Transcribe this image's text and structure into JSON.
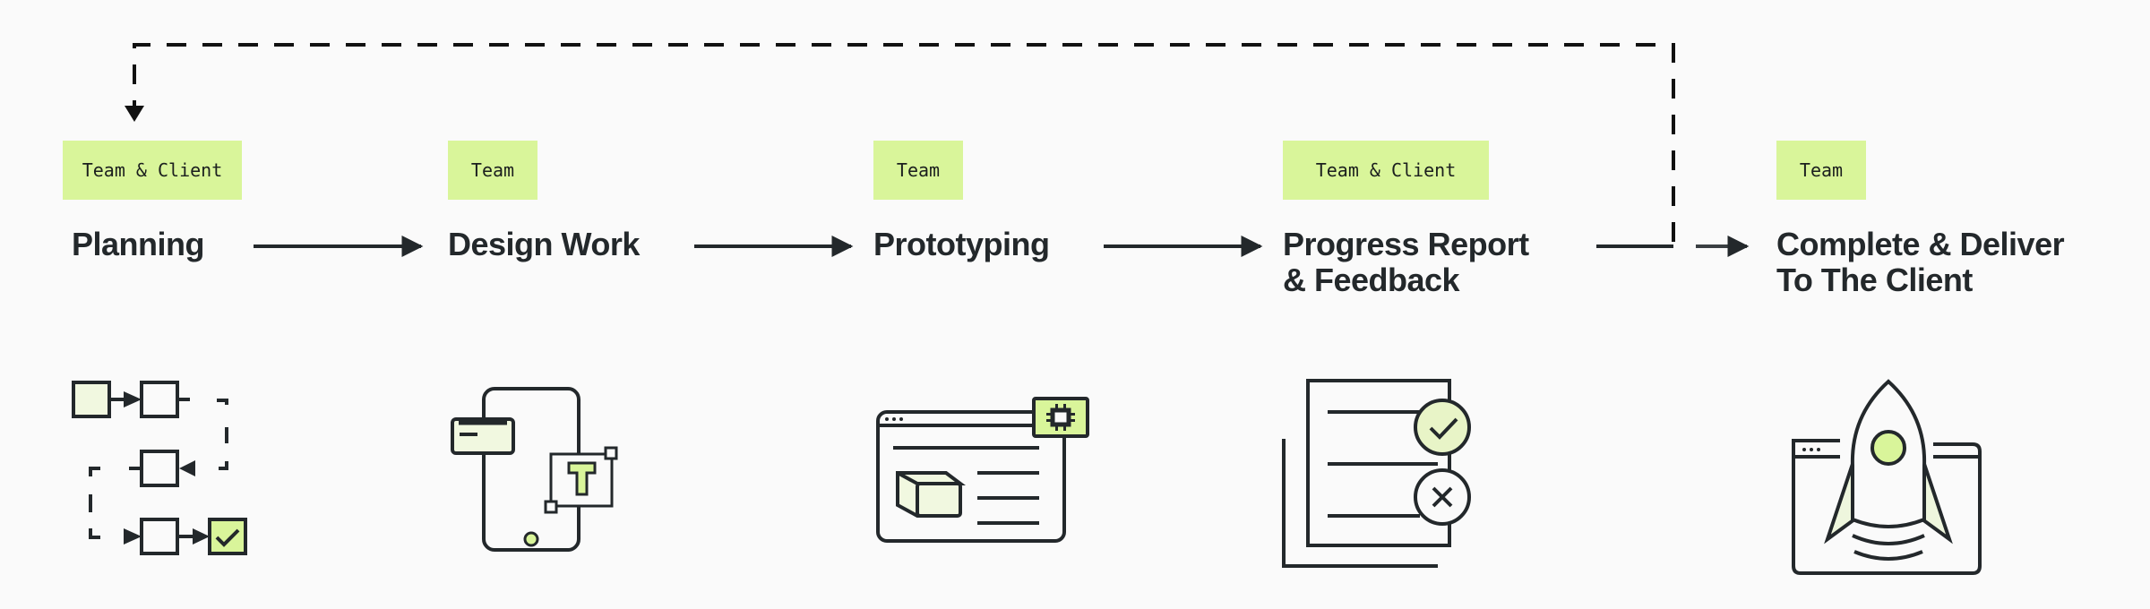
{
  "steps": [
    {
      "tag": "Team & Client",
      "title_line1": "Planning",
      "title_line2": "",
      "icon": "flowchart-icon"
    },
    {
      "tag": "Team",
      "title_line1": "Design Work",
      "title_line2": "",
      "icon": "mobile-design-icon"
    },
    {
      "tag": "Team",
      "title_line1": "Prototyping",
      "title_line2": "",
      "icon": "browser-prototype-icon"
    },
    {
      "tag": "Team & Client",
      "title_line1": "Progress Report",
      "title_line2": "& Feedback",
      "icon": "document-review-icon"
    },
    {
      "tag": "Team",
      "title_line1": "Complete & Deliver",
      "title_line2": "To The Client",
      "icon": "rocket-launch-icon"
    }
  ],
  "colors": {
    "accent": "#d9f59a",
    "accent_light": "#f1f8e0",
    "ink": "#23282b",
    "background": "#fafafa"
  },
  "connectors": {
    "feedback_loop": "dashed-return-arrow",
    "forward": "solid-arrow"
  }
}
